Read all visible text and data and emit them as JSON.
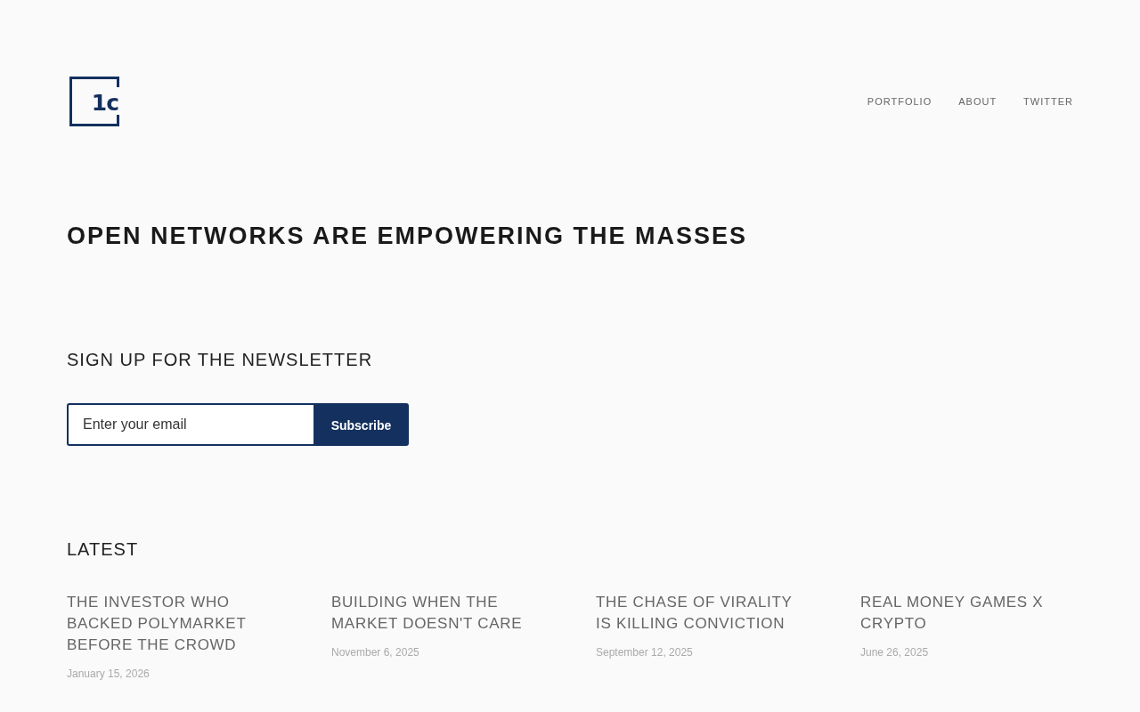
{
  "header": {
    "logo": {
      "text": "1c"
    },
    "nav": [
      {
        "label": "PORTFOLIO"
      },
      {
        "label": "ABOUT"
      },
      {
        "label": "TWITTER"
      }
    ]
  },
  "hero": {
    "headline": "OPEN NETWORKS ARE EMPOWERING THE MASSES"
  },
  "newsletter": {
    "heading": "SIGN UP FOR THE NEWSLETTER",
    "email_field": {
      "placeholder": "Enter your email"
    },
    "button": "Subscribe"
  },
  "latest": {
    "heading": "LATEST",
    "posts": [
      {
        "title": "THE INVESTOR WHO BACKED POLYMARKET BEFORE THE CROWD",
        "date": "January 15, 2026"
      },
      {
        "title": "BUILDING WHEN THE MARKET DOESN'T CARE",
        "date": "November 6, 2025"
      },
      {
        "title": "THE CHASE OF VIRALITY IS KILLING CONVICTION",
        "date": "September 12, 2025"
      },
      {
        "title": "REAL MONEY GAMES X CRYPTO",
        "date": "June 26, 2025"
      }
    ]
  }
}
